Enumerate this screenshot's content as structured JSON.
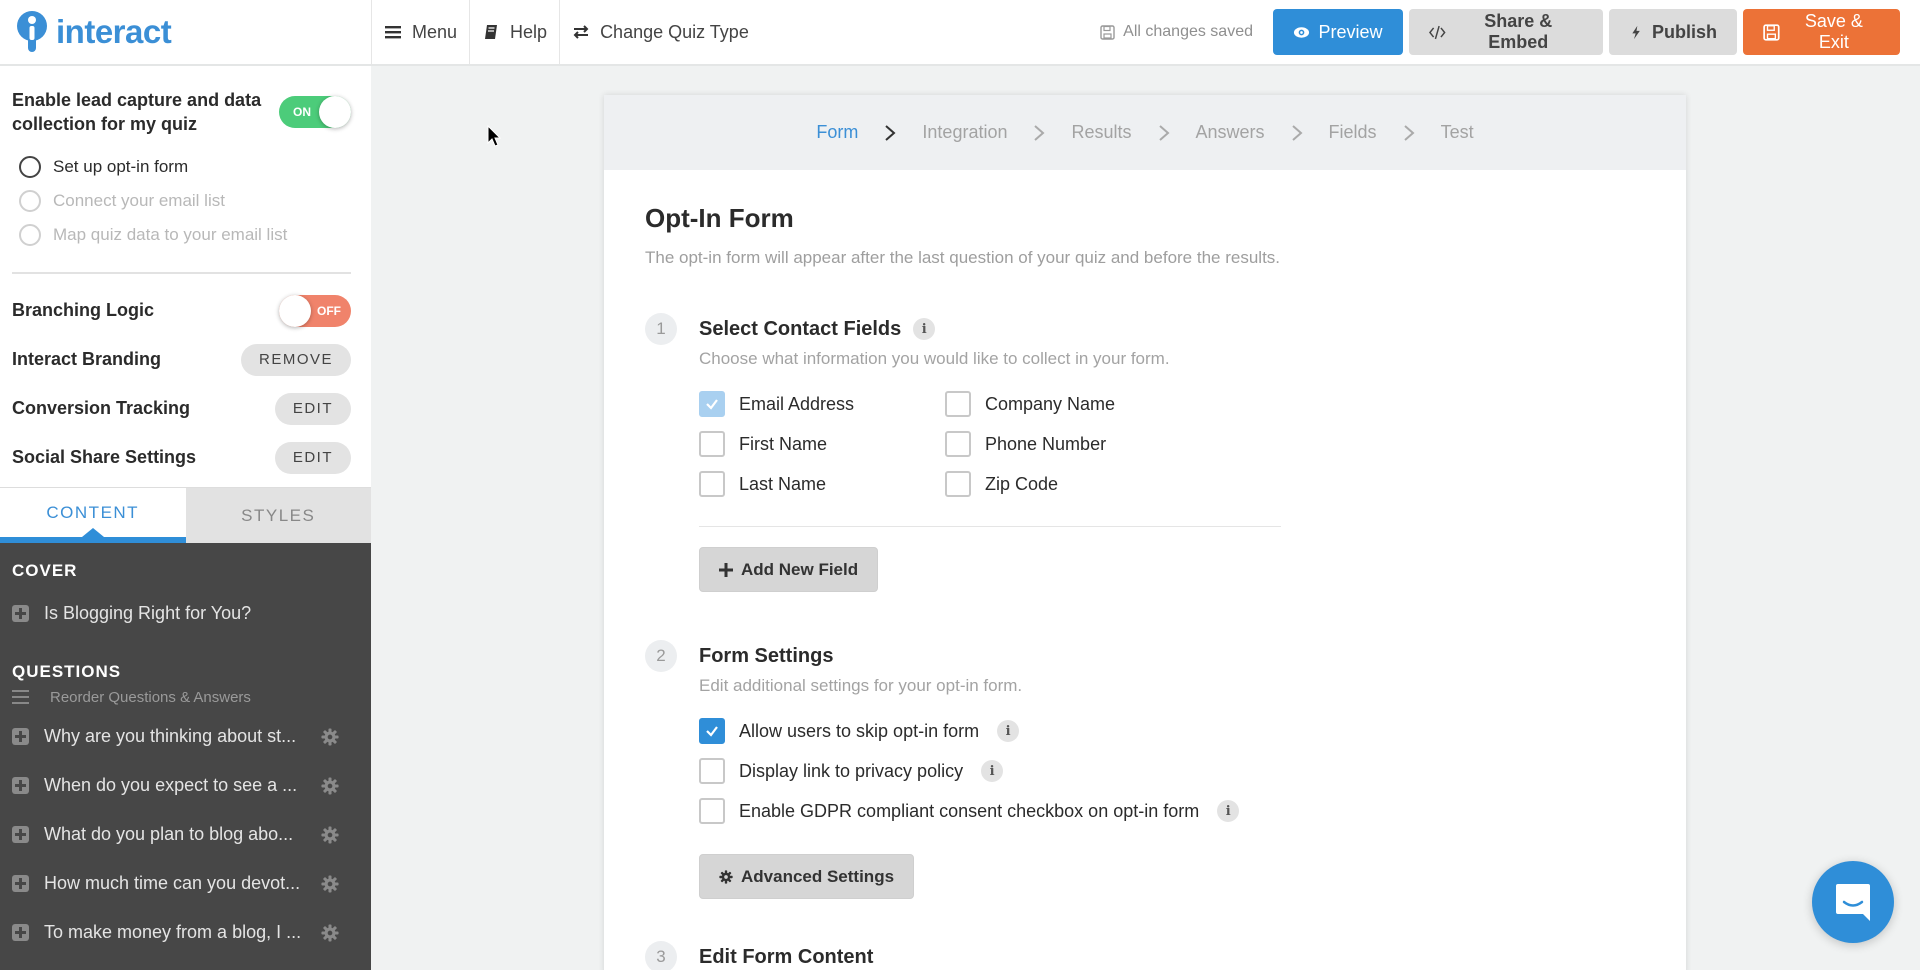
{
  "app": {
    "logo_text": "interact",
    "brand_color": "#3b8fd6"
  },
  "topbar": {
    "nav": [
      {
        "label": "Menu",
        "icon": "hamburger-icon"
      },
      {
        "label": "Help",
        "icon": "book-icon"
      },
      {
        "label": "Change Quiz Type",
        "icon": "swap-arrows-icon"
      }
    ],
    "save_status": "All changes saved",
    "buttons": {
      "preview": "Preview",
      "share": "Share & Embed",
      "publish": "Publish",
      "save_exit": "Save & Exit"
    },
    "colors": {
      "preview": "#2f8ed8",
      "save_exit": "#ec7237",
      "neutral": "#dcdcdc"
    }
  },
  "sidebar": {
    "lead_capture": {
      "label": "Enable lead capture and data collection for my quiz",
      "toggle": {
        "state": "on",
        "label": "ON"
      }
    },
    "steps": [
      {
        "label": "Set up opt-in form",
        "enabled": true
      },
      {
        "label": "Connect your email list",
        "enabled": false
      },
      {
        "label": "Map quiz data to your email list",
        "enabled": false
      }
    ],
    "options": [
      {
        "label": "Branching Logic",
        "control": "toggle",
        "state": "off",
        "toggle_label": "OFF"
      },
      {
        "label": "Interact Branding",
        "control": "button",
        "button_label": "REMOVE"
      },
      {
        "label": "Conversion Tracking",
        "control": "button",
        "button_label": "EDIT"
      },
      {
        "label": "Social Share Settings",
        "control": "button",
        "button_label": "EDIT"
      }
    ],
    "tabs": [
      {
        "label": "CONTENT",
        "active": true
      },
      {
        "label": "STYLES",
        "active": false
      }
    ],
    "content": {
      "cover_heading": "COVER",
      "cover_item": "Is Blogging Right for You?",
      "questions_heading": "QUESTIONS",
      "reorder_label": "Reorder Questions & Answers",
      "questions": [
        "Why are you thinking about st...",
        "When do you expect to see a ...",
        "What do you plan to blog abo...",
        "How much time can you devot...",
        "To make money from a blog, I ..."
      ]
    }
  },
  "main": {
    "wizard_steps": [
      {
        "label": "Form",
        "active": true
      },
      {
        "label": "Integration",
        "active": false
      },
      {
        "label": "Results",
        "active": false
      },
      {
        "label": "Answers",
        "active": false
      },
      {
        "label": "Fields",
        "active": false
      },
      {
        "label": "Test",
        "active": false
      }
    ],
    "title": "Opt-In Form",
    "subtitle": "The opt-in form will appear after the last question of your quiz and before the results.",
    "sections": [
      {
        "number": "1",
        "title": "Select Contact Fields",
        "subtitle": "Choose what information you would like to collect in your form.",
        "fields": [
          {
            "label": "Email Address",
            "checked": true,
            "locked": true
          },
          {
            "label": "Company Name",
            "checked": false
          },
          {
            "label": "First Name",
            "checked": false
          },
          {
            "label": "Phone Number",
            "checked": false
          },
          {
            "label": "Last Name",
            "checked": false
          },
          {
            "label": "Zip Code",
            "checked": false
          }
        ],
        "button": "Add New Field"
      },
      {
        "number": "2",
        "title": "Form Settings",
        "subtitle": "Edit additional settings for your opt-in form.",
        "settings": [
          {
            "label": "Allow users to skip opt-in form",
            "checked": true
          },
          {
            "label": "Display link to privacy policy",
            "checked": false
          },
          {
            "label": "Enable GDPR compliant consent checkbox on opt-in form",
            "checked": false
          }
        ],
        "button": "Advanced Settings"
      },
      {
        "number": "3",
        "title": "Edit Form Content"
      }
    ]
  },
  "chat_widget": {
    "icon": "chat-icon",
    "color": "#2f8ed8"
  }
}
